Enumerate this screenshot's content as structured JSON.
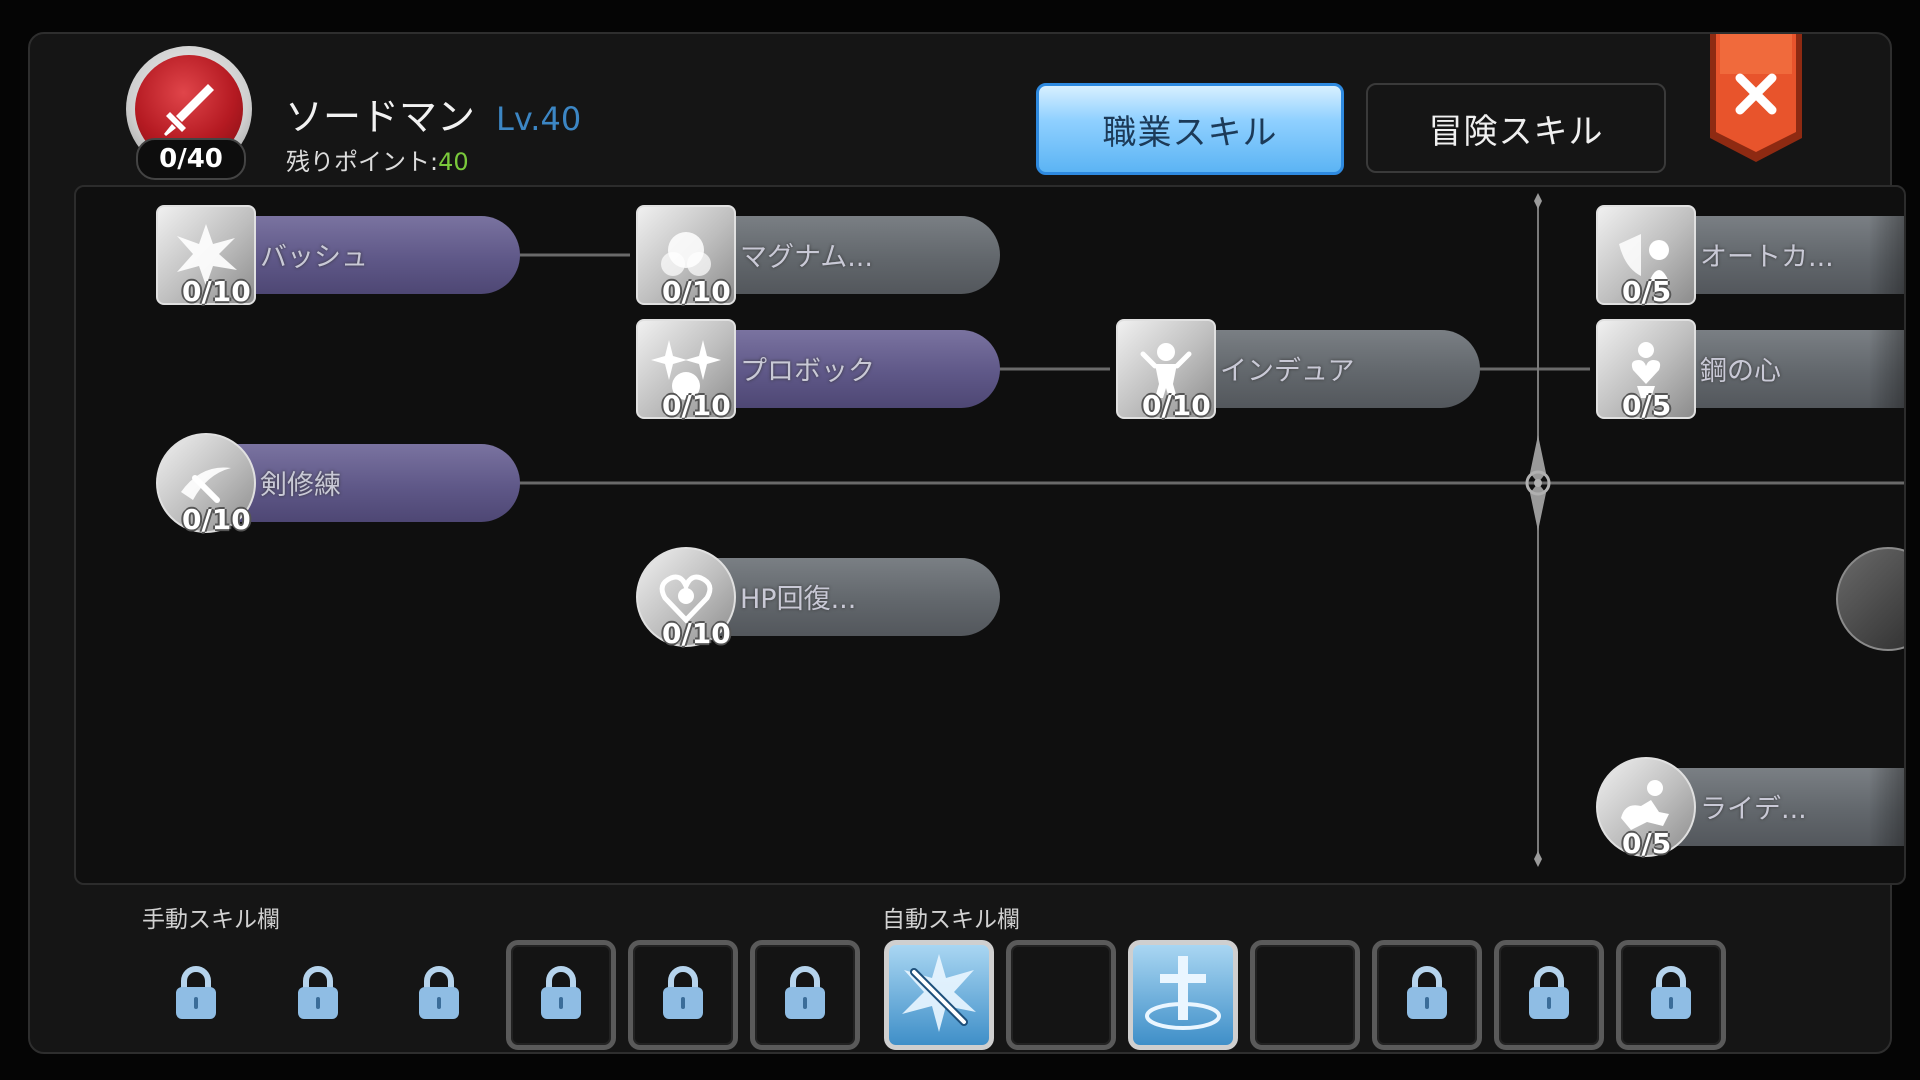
{
  "header": {
    "class_points": "0/40",
    "class_name": "ソードマン",
    "class_level": "Lv.40",
    "remaining_label": "残りポイント:",
    "remaining_value": "40",
    "tabs": [
      {
        "label": "職業スキル",
        "active": true
      },
      {
        "label": "冒険スキル",
        "active": false
      }
    ],
    "close_icon": "close-icon",
    "emblem_icon": "sword-icon"
  },
  "skills": [
    {
      "name": "バッシュ",
      "level": "0/10",
      "state": "unlocked"
    },
    {
      "name": "マグナム...",
      "level": "0/10",
      "state": "locked"
    },
    {
      "name": "オートカ...",
      "level": "0/5",
      "state": "locked"
    },
    {
      "name": "プロボック",
      "level": "0/10",
      "state": "unlocked"
    },
    {
      "name": "インデュア",
      "level": "0/10",
      "state": "locked"
    },
    {
      "name": "鋼の心",
      "level": "0/5",
      "state": "locked"
    },
    {
      "name": "剣修練",
      "level": "0/10",
      "state": "unlocked"
    },
    {
      "name": "HP回復...",
      "level": "0/10",
      "state": "locked"
    },
    {
      "name": "ライデ...",
      "level": "0/5",
      "state": "locked"
    }
  ],
  "slots": {
    "manual_label": "手動スキル欄",
    "auto_label": "自動スキル欄",
    "items": [
      {
        "type": "locked",
        "framed": false
      },
      {
        "type": "locked",
        "framed": false
      },
      {
        "type": "locked",
        "framed": false
      },
      {
        "type": "locked",
        "framed": true
      },
      {
        "type": "locked",
        "framed": true
      },
      {
        "type": "locked",
        "framed": true
      },
      {
        "type": "skill",
        "icon": "bash-sword-icon"
      },
      {
        "type": "empty"
      },
      {
        "type": "skill",
        "icon": "holy-cross-icon"
      },
      {
        "type": "empty"
      },
      {
        "type": "locked",
        "framed": true
      },
      {
        "type": "locked",
        "framed": true
      },
      {
        "type": "locked",
        "framed": true
      }
    ]
  },
  "colors": {
    "accent_blue": "#5cb4f4",
    "level_blue": "#3c86c4",
    "points_green": "#7ac93b",
    "close_orange": "#e8542c",
    "learnable_bar": "#5f5888",
    "locked_bar": "#62676c"
  }
}
